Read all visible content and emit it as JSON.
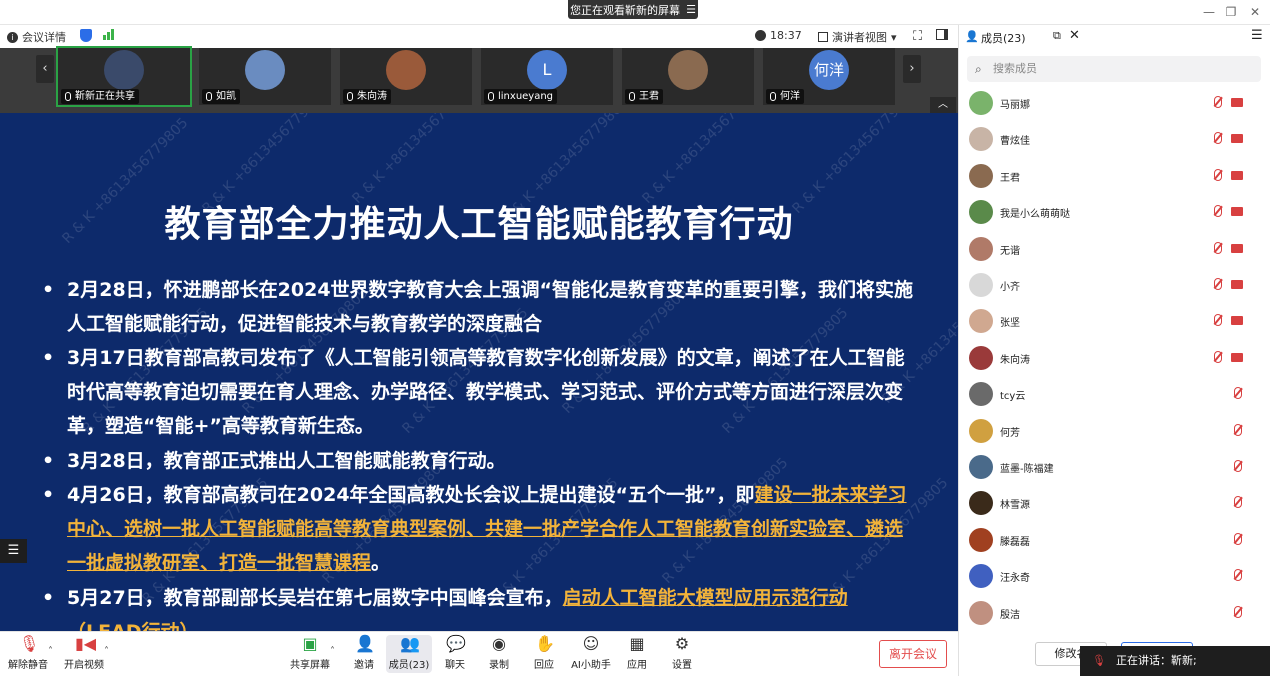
{
  "titlebar": {
    "share_banner": "您正在观看靳新的屏幕",
    "banner_icon": "menu-icon"
  },
  "top_toolbar": {
    "meeting_details": "会议详情",
    "time": "18:37",
    "view_mode": "演讲者视图"
  },
  "video_strip": [
    {
      "name": "靳新正在共享",
      "avatar": "#3a4a6a"
    },
    {
      "name": "如凯",
      "avatar": "#6a8cc0"
    },
    {
      "name": "朱向涛",
      "avatar": "#9a5a3a"
    },
    {
      "name": "linxueyang",
      "avatar": "#4a7bd0",
      "letter": "L"
    },
    {
      "name": "王君",
      "avatar": "#8a6a50"
    },
    {
      "name": "何洋",
      "avatar": "#4a7bd0",
      "letter": "何洋"
    }
  ],
  "slide": {
    "title": "教育部全力推动人工智能赋能教育行动",
    "b1": "2月28日，怀进鹏部长在2024世界数字教育大会上强调“智能化是教育变革的重要引擎，我们将实施人工智能赋能行动，促进智能技术与教育教学的深度融合",
    "b2": "3月17日教育部高教司发布了《人工智能引领高等教育数字化创新发展》的文章，阐述了在人工智能时代高等教育迫切需要在育人理念、办学路径、教学模式、学习范式、评价方式等方面进行深层次变革，塑造“智能+”高等教育新生态。",
    "b3": "3月28日，教育部正式推出人工智能赋能教育行动。",
    "b4_a": "4月26日，教育部高教司在2024年全国高教处长会议上提出建设“五个一批”，即",
    "b4_hl": "建设一批未来学习中心、选树一批人工智能赋能高等教育典型案例、共建一批产学合作人工智能教育创新实验室、遴选一批虚拟教研室、打造一批智慧课程",
    "b4_end": "。",
    "b5_a": "5月27日，教育部副部长吴岩在第七届数字中国峰会宣布，",
    "b5_hl": "启动人工智能大模型应用示范行动（LEAD行动）",
    "watermark": "R & K +8613456779805"
  },
  "bottom_toolbar": {
    "unmute": "解除静音",
    "start_video": "开启视频",
    "share_screen": "共享屏幕",
    "invite": "邀请",
    "members": "成员(23)",
    "chat": "聊天",
    "record": "录制",
    "reply": "回应",
    "ai_assistant": "AI小助手",
    "apps": "应用",
    "settings": "设置",
    "leave": "离开会议"
  },
  "panel": {
    "title": "成员(23)",
    "search_placeholder": "搜索成员",
    "members": [
      {
        "name": "马丽娜",
        "avatar": "#7ab36b",
        "cam": true
      },
      {
        "name": "曹炫佳",
        "avatar": "#c8b4a6",
        "cam": true
      },
      {
        "name": "王君",
        "avatar": "#8a6a50",
        "cam": true
      },
      {
        "name": "我是小么萌萌哒",
        "avatar": "#5a8a4a",
        "cam": true
      },
      {
        "name": "无谐",
        "avatar": "#b07a68",
        "cam": true
      },
      {
        "name": "小齐",
        "avatar": "#d8d8d8",
        "cam": true
      },
      {
        "name": "张坚",
        "avatar": "#d0a890",
        "cam": true
      },
      {
        "name": "朱向涛",
        "avatar": "#9a3a3a",
        "cam": true
      },
      {
        "name": "tcy云",
        "avatar": "#6a6a6a",
        "cam": false
      },
      {
        "name": "何芳",
        "avatar": "#d0a040",
        "cam": false
      },
      {
        "name": "蓝墨-陈福建",
        "avatar": "#4a6a8a",
        "cam": false
      },
      {
        "name": "林雪源",
        "avatar": "#3a2a1a",
        "cam": false
      },
      {
        "name": "滕磊磊",
        "avatar": "#a04020",
        "cam": false
      },
      {
        "name": "汪永奇",
        "avatar": "#4060c0",
        "cam": false
      },
      {
        "name": "殷洁",
        "avatar": "#c09080",
        "cam": false
      }
    ],
    "rename_button": "修改名",
    "speaking": "正在讲话：靳新;"
  }
}
